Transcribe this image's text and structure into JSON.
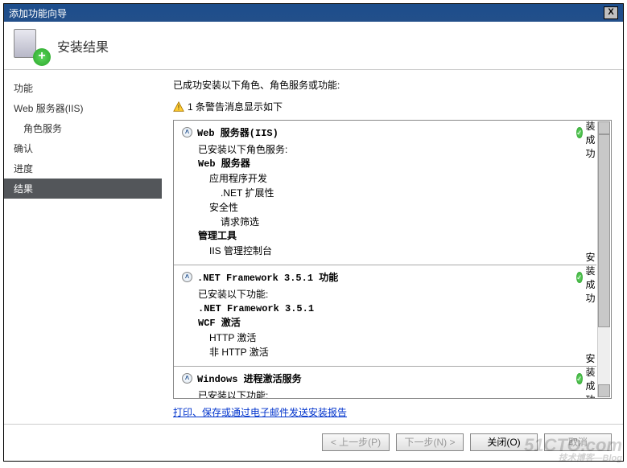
{
  "window": {
    "title": "添加功能向导",
    "close_label": "X"
  },
  "header": {
    "title": "安装结果"
  },
  "sidebar": {
    "items": [
      {
        "label": "功能",
        "indent": false
      },
      {
        "label": "Web 服务器(IIS)",
        "indent": false
      },
      {
        "label": "角色服务",
        "indent": true
      },
      {
        "label": "确认",
        "indent": false
      },
      {
        "label": "进度",
        "indent": false
      },
      {
        "label": "结果",
        "indent": false,
        "selected": true
      }
    ]
  },
  "main": {
    "summary": "已成功安装以下角色、角色服务或功能:",
    "warning": "1 条警告消息显示如下",
    "link": "打印、保存或通过电子邮件发送安装报告",
    "status_success": "安装成功",
    "groups": [
      {
        "title": "Web 服务器(IIS)",
        "status": "success",
        "intro": "已安装以下角色服务:",
        "lines": [
          {
            "text": "Web 服务器",
            "indent": 0,
            "bold": true
          },
          {
            "text": "应用程序开发",
            "indent": 1
          },
          {
            "text": ".NET 扩展性",
            "indent": 2
          },
          {
            "text": "安全性",
            "indent": 1
          },
          {
            "text": "请求筛选",
            "indent": 2
          },
          {
            "text": "管理工具",
            "indent": 0,
            "bold": true
          },
          {
            "text": "IIS 管理控制台",
            "indent": 1
          }
        ]
      },
      {
        "title": ".NET Framework 3.5.1 功能",
        "status": "success",
        "intro": "已安装以下功能:",
        "lines": [
          {
            "text": ".NET Framework 3.5.1",
            "indent": 0,
            "bold": true
          },
          {
            "text": "WCF 激活",
            "indent": 0,
            "bold": true
          },
          {
            "text": "HTTP 激活",
            "indent": 1
          },
          {
            "text": "非 HTTP 激活",
            "indent": 1
          }
        ]
      },
      {
        "title": "Windows 进程激活服务",
        "status": "success",
        "intro": "已安装以下功能:",
        "lines": []
      }
    ]
  },
  "buttons": {
    "prev": "< 上一步(P)",
    "next": "下一步(N) >",
    "close": "关闭(O)",
    "cancel": "取消"
  },
  "watermark": {
    "main": "51CTO.com",
    "sub": "技术博客—Blog"
  }
}
